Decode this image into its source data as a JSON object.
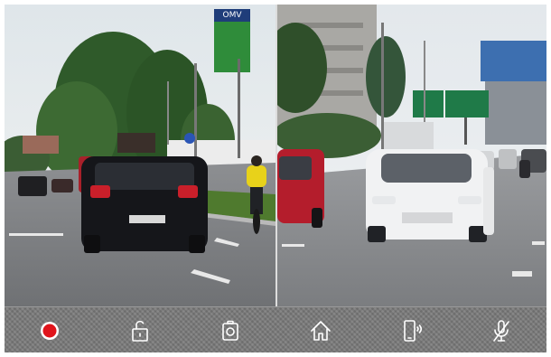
{
  "feeds": [
    {
      "sign_text": "OMV"
    },
    {
      "sign_text": ""
    }
  ],
  "toolbar": {
    "buttons": [
      {
        "icon": "record-icon",
        "color": "#e0141b"
      },
      {
        "icon": "unlock-icon"
      },
      {
        "icon": "camera-icon"
      },
      {
        "icon": "home-icon"
      },
      {
        "icon": "phone-vibrate-icon"
      },
      {
        "icon": "microphone-off-icon"
      }
    ]
  },
  "colors": {
    "toolbar_bg": "#7a7a7a",
    "icon_stroke": "#ffffff",
    "record": "#e0141b"
  }
}
